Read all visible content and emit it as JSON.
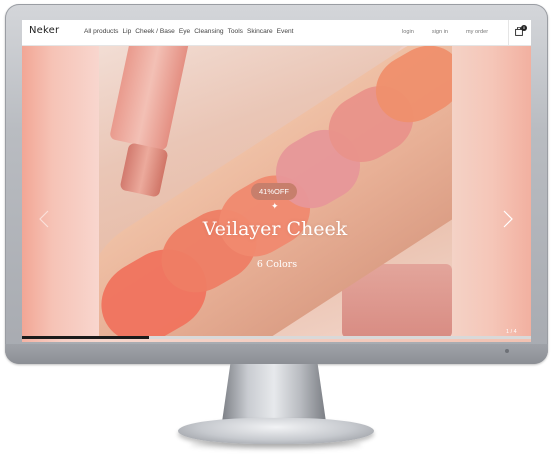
{
  "header": {
    "logo": "Neker",
    "menu": [
      "All products",
      "Lip",
      "Cheek / Base",
      "Eye",
      "Cleansing",
      "Tools",
      "Skincare",
      "Event"
    ],
    "auth": [
      "login",
      "sign in",
      "my order"
    ],
    "cart_count": "0"
  },
  "hero": {
    "badge": "41%OFF",
    "title": "Veilayer Cheek",
    "subtitle": "6 Colors",
    "pager": "1 / 4",
    "progress": 0.25
  },
  "colors": {
    "accent": "#c77f6c",
    "progress": "#1b1b1b"
  },
  "icons": {
    "cart": "shopping-bag-icon",
    "prev": "chevron-left-icon",
    "next": "chevron-right-icon"
  }
}
